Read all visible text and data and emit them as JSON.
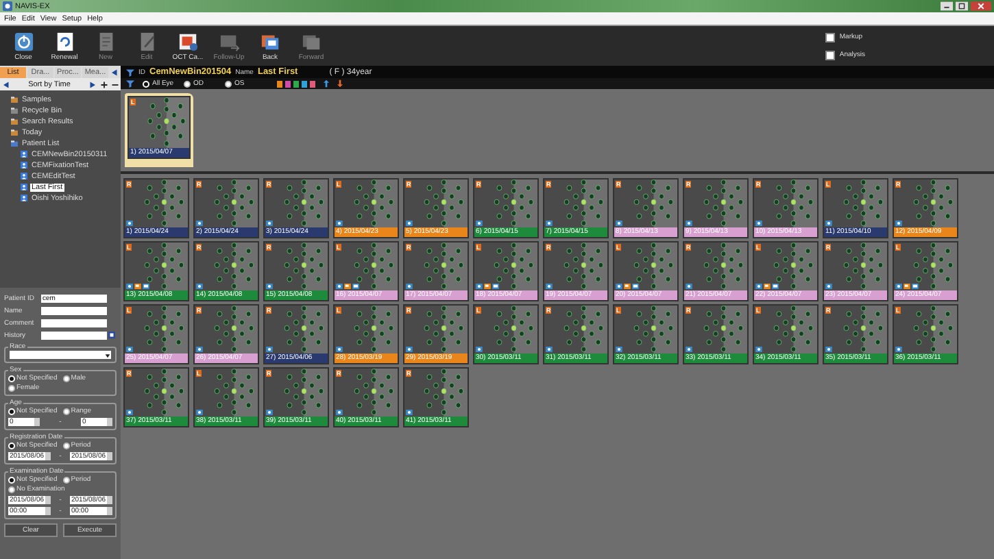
{
  "window": {
    "title": "NAVIS-EX"
  },
  "menu": [
    "File",
    "Edit",
    "View",
    "Setup",
    "Help"
  ],
  "toolbar": [
    {
      "label": "Close",
      "kind": "power",
      "disabled": false
    },
    {
      "label": "Renewal",
      "kind": "renew",
      "disabled": false
    },
    {
      "label": "New",
      "kind": "new",
      "disabled": true
    },
    {
      "label": "Edit",
      "kind": "edit",
      "disabled": true
    },
    {
      "label": "OCT Ca...",
      "kind": "oct",
      "disabled": false
    },
    {
      "label": "Follow-Up",
      "kind": "followup",
      "disabled": true
    },
    {
      "label": "Back",
      "kind": "back",
      "disabled": false
    },
    {
      "label": "Forward",
      "kind": "forward",
      "disabled": true
    }
  ],
  "options": [
    {
      "label": "Markup",
      "checked": false
    },
    {
      "label": "Analysis",
      "checked": false
    }
  ],
  "left_tabs": [
    {
      "label": "List",
      "selected": true
    },
    {
      "label": "Dra...",
      "selected": false
    },
    {
      "label": "Proc...",
      "selected": false
    },
    {
      "label": "Mea...",
      "selected": false
    }
  ],
  "sort": {
    "label": "Sort by Time"
  },
  "tree": [
    {
      "label": "Samples",
      "kind": "folder",
      "selected": false
    },
    {
      "label": "Recycle Bin",
      "kind": "bin",
      "selected": false
    },
    {
      "label": "Search Results",
      "kind": "folder",
      "selected": false
    },
    {
      "label": "Today",
      "kind": "folder",
      "selected": false
    },
    {
      "label": "Patient List",
      "kind": "patients",
      "selected": false,
      "children": [
        {
          "label": "CEMNewBin20150311",
          "kind": "patient",
          "selected": false
        },
        {
          "label": "CEMFixationTest",
          "kind": "patient",
          "selected": false
        },
        {
          "label": "CEMEditTest",
          "kind": "patient",
          "selected": false
        },
        {
          "label": "Last  First",
          "kind": "patient",
          "selected": true
        },
        {
          "label": "Oishi  Yoshihiko",
          "kind": "patient",
          "selected": false
        }
      ]
    }
  ],
  "search_form": {
    "fields": [
      {
        "label": "Patient ID",
        "value": "cem"
      },
      {
        "label": "Name"
      },
      {
        "label": "Comment"
      },
      {
        "label": "History"
      }
    ],
    "race": {
      "title": "Race"
    },
    "sex": {
      "title": "Sex",
      "options": [
        {
          "label": "Not Specified",
          "selected": true
        },
        {
          "label": "Male",
          "selected": false
        },
        {
          "label": "Female",
          "selected": false
        }
      ]
    },
    "age": {
      "title": "Age",
      "options": [
        {
          "label": "Not Specified",
          "selected": true
        },
        {
          "label": "Range",
          "selected": false
        }
      ],
      "from": "0",
      "separator": "-",
      "to": "0"
    },
    "registration": {
      "title": "Registration Date",
      "options": [
        {
          "label": "Not Specified",
          "selected": true
        },
        {
          "label": "Period",
          "selected": false
        }
      ],
      "from": "2015/08/06",
      "separator": "-",
      "to": "2015/08/06"
    },
    "examination": {
      "title": "Examination Date",
      "options": [
        {
          "label": "Not Specified",
          "selected": true
        },
        {
          "label": "Period",
          "selected": false
        },
        {
          "label": "No Examination",
          "selected": false
        }
      ],
      "from": "2015/08/06",
      "separator": "-",
      "to": "2015/08/06",
      "time_from": "00:00",
      "time_separator": "-",
      "time_to": "00:00"
    },
    "buttons": [
      "Clear",
      "Execute"
    ]
  },
  "patient": {
    "id_label": "ID",
    "id": "CemNewBin201504",
    "name_label": "Name",
    "name": "Last  First",
    "info": "( F )  34year"
  },
  "eye_filter": [
    {
      "label": "All Eye",
      "selected": true
    },
    {
      "label": "OD",
      "selected": false
    },
    {
      "label": "OS",
      "selected": false
    }
  ],
  "color_filters": [
    {
      "color": "#e8861c"
    },
    {
      "color": "#d04aa8"
    },
    {
      "color": "#2ea84a"
    },
    {
      "color": "#30a0d8"
    },
    {
      "color": "#e05a7a"
    }
  ],
  "pinned": [
    {
      "eye": "L",
      "label": "1) 2015/04/07",
      "color": "#2a3a6e"
    }
  ],
  "exams": [
    {
      "eye": "R",
      "label": "1) 2015/04/24",
      "color": "#2a3a6e",
      "extra_icons": false
    },
    {
      "eye": "R",
      "label": "2) 2015/04/24",
      "color": "#2a3a6e",
      "extra_icons": false
    },
    {
      "eye": "R",
      "label": "3) 2015/04/24",
      "color": "#2a3a6e",
      "extra_icons": false
    },
    {
      "eye": "L",
      "label": "4) 2015/04/23",
      "color": "#e8861c",
      "extra_icons": false
    },
    {
      "eye": "R",
      "label": "5) 2015/04/23",
      "color": "#e8861c",
      "extra_icons": false
    },
    {
      "eye": "R",
      "label": "6) 2015/04/15",
      "color": "#1e8a3c",
      "extra_icons": false
    },
    {
      "eye": "R",
      "label": "7) 2015/04/15",
      "color": "#1e8a3c",
      "extra_icons": false
    },
    {
      "eye": "R",
      "label": "8) 2015/04/13",
      "color": "#d8a0d0",
      "extra_icons": false
    },
    {
      "eye": "R",
      "label": "9) 2015/04/13",
      "color": "#d8a0d0",
      "extra_icons": false
    },
    {
      "eye": "R",
      "label": "10) 2015/04/13",
      "color": "#d8a0d0",
      "extra_icons": false
    },
    {
      "eye": "L",
      "label": "11) 2015/04/10",
      "color": "#2a3a6e",
      "extra_icons": false
    },
    {
      "eye": "R",
      "label": "12) 2015/04/09",
      "color": "#e8861c",
      "extra_icons": false
    },
    {
      "eye": "L",
      "label": "13) 2015/04/08",
      "color": "#1e8a3c",
      "extra_icons": true
    },
    {
      "eye": "R",
      "label": "14) 2015/04/08",
      "color": "#1e8a3c",
      "extra_icons": false
    },
    {
      "eye": "R",
      "label": "15) 2015/04/08",
      "color": "#1e8a3c",
      "extra_icons": false
    },
    {
      "eye": "L",
      "label": "16) 2015/04/07",
      "color": "#d8a0d0",
      "extra_icons": true
    },
    {
      "eye": "R",
      "label": "17) 2015/04/07",
      "color": "#d8a0d0",
      "extra_icons": false
    },
    {
      "eye": "L",
      "label": "18) 2015/04/07",
      "color": "#d8a0d0",
      "extra_icons": true
    },
    {
      "eye": "R",
      "label": "19) 2015/04/07",
      "color": "#d8a0d0",
      "extra_icons": false
    },
    {
      "eye": "L",
      "label": "20) 2015/04/07",
      "color": "#d8a0d0",
      "extra_icons": true
    },
    {
      "eye": "R",
      "label": "21) 2015/04/07",
      "color": "#d8a0d0",
      "extra_icons": false
    },
    {
      "eye": "L",
      "label": "22) 2015/04/07",
      "color": "#d8a0d0",
      "extra_icons": true
    },
    {
      "eye": "R",
      "label": "23) 2015/04/07",
      "color": "#d8a0d0",
      "extra_icons": false
    },
    {
      "eye": "L",
      "label": "24) 2015/04/07",
      "color": "#d8a0d0",
      "extra_icons": true
    },
    {
      "eye": "L",
      "label": "25) 2015/04/07",
      "color": "#d8a0d0",
      "extra_icons": false
    },
    {
      "eye": "R",
      "label": "26) 2015/04/07",
      "color": "#d8a0d0",
      "extra_icons": false
    },
    {
      "eye": "R",
      "label": "27) 2015/04/06",
      "color": "#2a3a6e",
      "extra_icons": false
    },
    {
      "eye": "L",
      "label": "28) 2015/03/19",
      "color": "#e8861c",
      "extra_icons": false
    },
    {
      "eye": "R",
      "label": "29) 2015/03/19",
      "color": "#e8861c",
      "extra_icons": false
    },
    {
      "eye": "L",
      "label": "30) 2015/03/11",
      "color": "#1e8a3c",
      "extra_icons": false
    },
    {
      "eye": "R",
      "label": "31) 2015/03/11",
      "color": "#1e8a3c",
      "extra_icons": false
    },
    {
      "eye": "L",
      "label": "32) 2015/03/11",
      "color": "#1e8a3c",
      "extra_icons": false
    },
    {
      "eye": "R",
      "label": "33) 2015/03/11",
      "color": "#1e8a3c",
      "extra_icons": false
    },
    {
      "eye": "L",
      "label": "34) 2015/03/11",
      "color": "#1e8a3c",
      "extra_icons": false
    },
    {
      "eye": "R",
      "label": "35) 2015/03/11",
      "color": "#1e8a3c",
      "extra_icons": false
    },
    {
      "eye": "L",
      "label": "36) 2015/03/11",
      "color": "#1e8a3c",
      "extra_icons": false
    },
    {
      "eye": "R",
      "label": "37) 2015/03/11",
      "color": "#1e8a3c",
      "extra_icons": false
    },
    {
      "eye": "L",
      "label": "38) 2015/03/11",
      "color": "#1e8a3c",
      "extra_icons": false
    },
    {
      "eye": "R",
      "label": "39) 2015/03/11",
      "color": "#1e8a3c",
      "extra_icons": false
    },
    {
      "eye": "R",
      "label": "40) 2015/03/11",
      "color": "#1e8a3c",
      "extra_icons": false
    },
    {
      "eye": "R",
      "label": "41) 2015/03/11",
      "color": "#1e8a3c",
      "extra_icons": false
    }
  ]
}
